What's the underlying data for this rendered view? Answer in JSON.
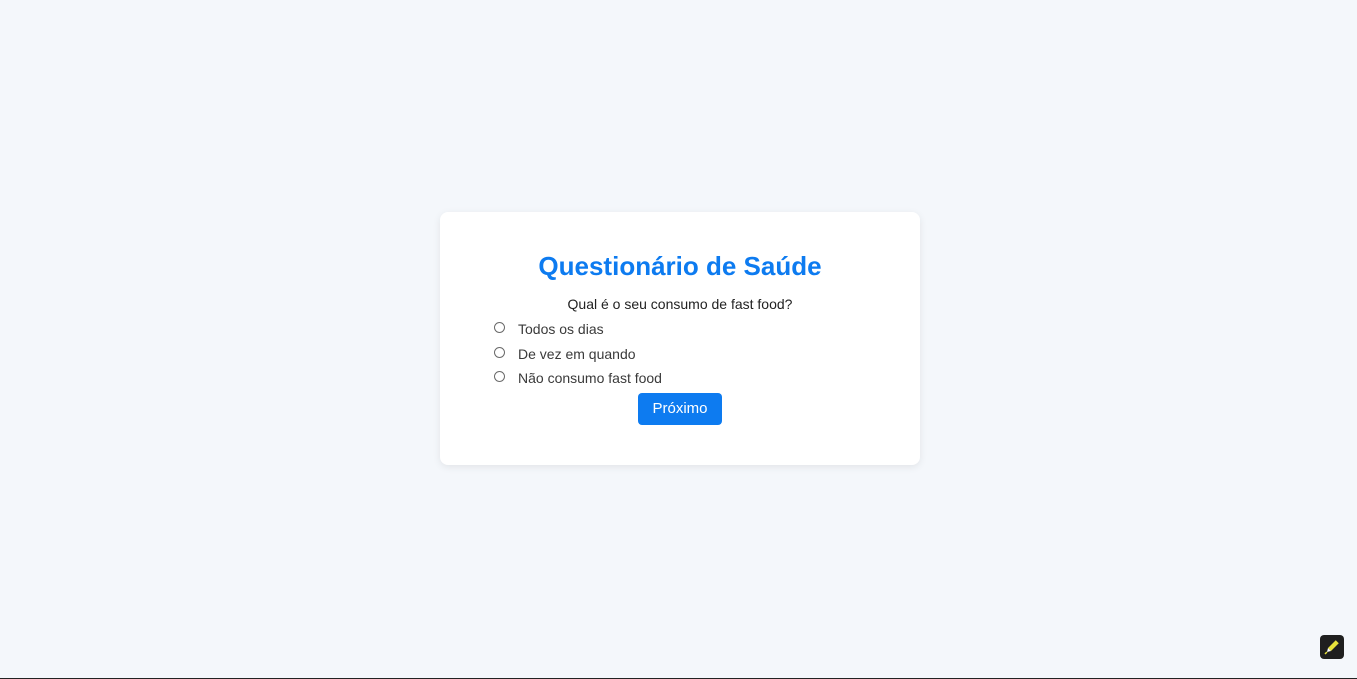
{
  "survey": {
    "title": "Questionário de Saúde",
    "question": "Qual é o seu consumo de fast food?",
    "options": [
      {
        "label": "Todos os dias",
        "selected": false
      },
      {
        "label": "De vez em quando",
        "selected": false
      },
      {
        "label": "Não consumo fast food",
        "selected": false
      }
    ],
    "next_label": "Próximo"
  },
  "colors": {
    "background": "#f4f7fb",
    "card": "#ffffff",
    "accent": "#0d7bf0"
  },
  "icons": {
    "corner_widget": "pen-icon"
  }
}
